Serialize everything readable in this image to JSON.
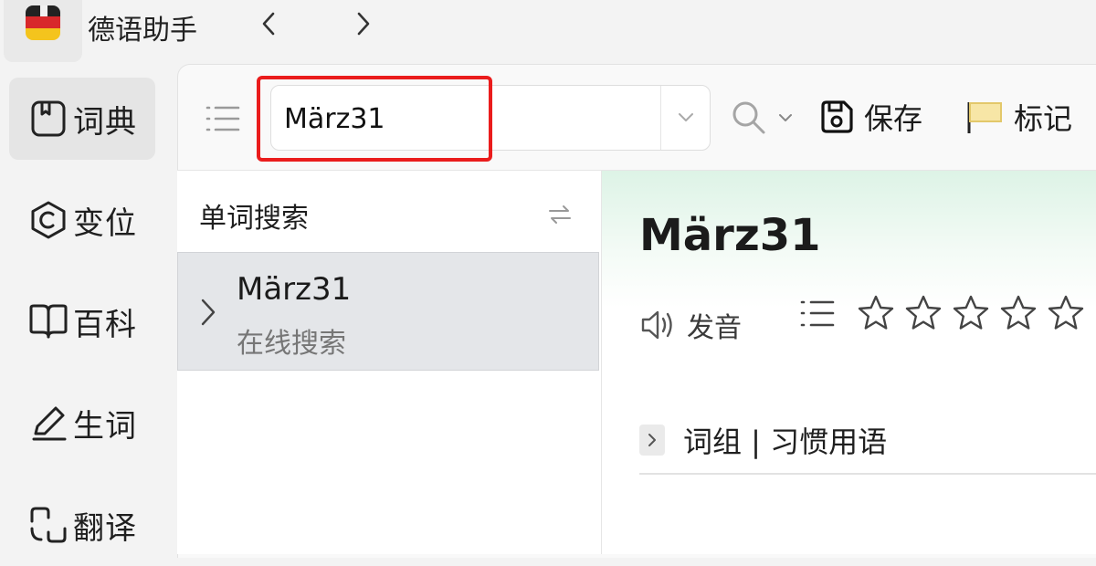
{
  "app": {
    "title": "德语助手",
    "icon": "app-icon-german-flag",
    "nav_back_icon": "chevron-left-icon",
    "nav_forward_icon": "chevron-right-icon"
  },
  "sidebar": {
    "items": [
      {
        "id": "dictionary",
        "label": "词典",
        "icon": "book-icon",
        "active": true
      },
      {
        "id": "conjugation",
        "label": "变位",
        "icon": "conjugation-c-icon",
        "active": false
      },
      {
        "id": "encyclopedia",
        "label": "百科",
        "icon": "open-book-icon",
        "active": false
      },
      {
        "id": "vocabulary",
        "label": "生词",
        "icon": "pencil-icon",
        "active": false
      },
      {
        "id": "translate",
        "label": "翻译",
        "icon": "translate-icon",
        "active": false
      }
    ]
  },
  "toolbar": {
    "search_value": "März31",
    "save_label": "保存",
    "mark_label": "标记"
  },
  "word_list": {
    "header": "单词搜索",
    "items": [
      {
        "word": "März31",
        "subtitle": "在线搜索"
      }
    ]
  },
  "detail": {
    "headword": "März31",
    "pronounce_label": "发音",
    "rating_stars": 5,
    "rating_value": 0,
    "phrases_label": "词组 | 习惯用语"
  },
  "colors": {
    "highlight": "#ea1c1c",
    "flag_black": "#222222",
    "flag_red": "#d8282b",
    "flag_gold": "#f4c41d",
    "detail_header_tint": "#ddf3e6"
  }
}
